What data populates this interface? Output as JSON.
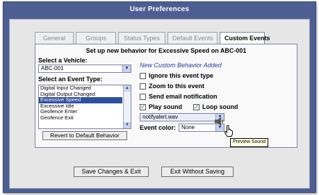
{
  "window": {
    "title": "User Preferences"
  },
  "tabs": [
    {
      "label": "General",
      "active": false
    },
    {
      "label": "Groups",
      "active": false
    },
    {
      "label": "Status Types",
      "active": false
    },
    {
      "label": "Default Events",
      "active": false
    },
    {
      "label": "Custom Events",
      "active": true
    }
  ],
  "heading": "Set up new behavior for Excessive Speed on ABC-001",
  "vehicle": {
    "label": "Select a Vehicle:",
    "selected": "ABC-001"
  },
  "event_type": {
    "label": "Select an Event Type:",
    "items": [
      "Digital Input Changed",
      "Digital Output Changed",
      "Excessive Speed",
      "Excessive Idle",
      "Geofence Enter",
      "Geofence Exit"
    ],
    "selected_index": 2
  },
  "revert_button": "Revert to Default Behavior",
  "status_text": "New Custom Behavior Added",
  "options": {
    "ignore": {
      "label": "Ignore this event type",
      "checked": false
    },
    "zoom": {
      "label": "Zoom to this event",
      "checked": false
    },
    "email": {
      "label": "Send email notification",
      "checked": false
    },
    "play_sound": {
      "label": "Play sound",
      "checked": true
    },
    "loop_sound": {
      "label": "Loop sound",
      "checked": true
    }
  },
  "sound_file": "notifyalert.wav",
  "event_color": {
    "label": "Event color:",
    "selected": "None"
  },
  "tooltip": "Preview Sound",
  "footer": {
    "save_label": "Save Changes & Exit",
    "exit_label": "Exit Without Saving"
  },
  "colors": {
    "frame": "#4d5f92",
    "selection": "#2f4f9f",
    "status_text": "#2a3d96",
    "checkmark": "#1a8a1a"
  },
  "icons": [
    "chevron-down-icon",
    "speaker-icon",
    "checkmark-icon",
    "hand-cursor-icon"
  ]
}
